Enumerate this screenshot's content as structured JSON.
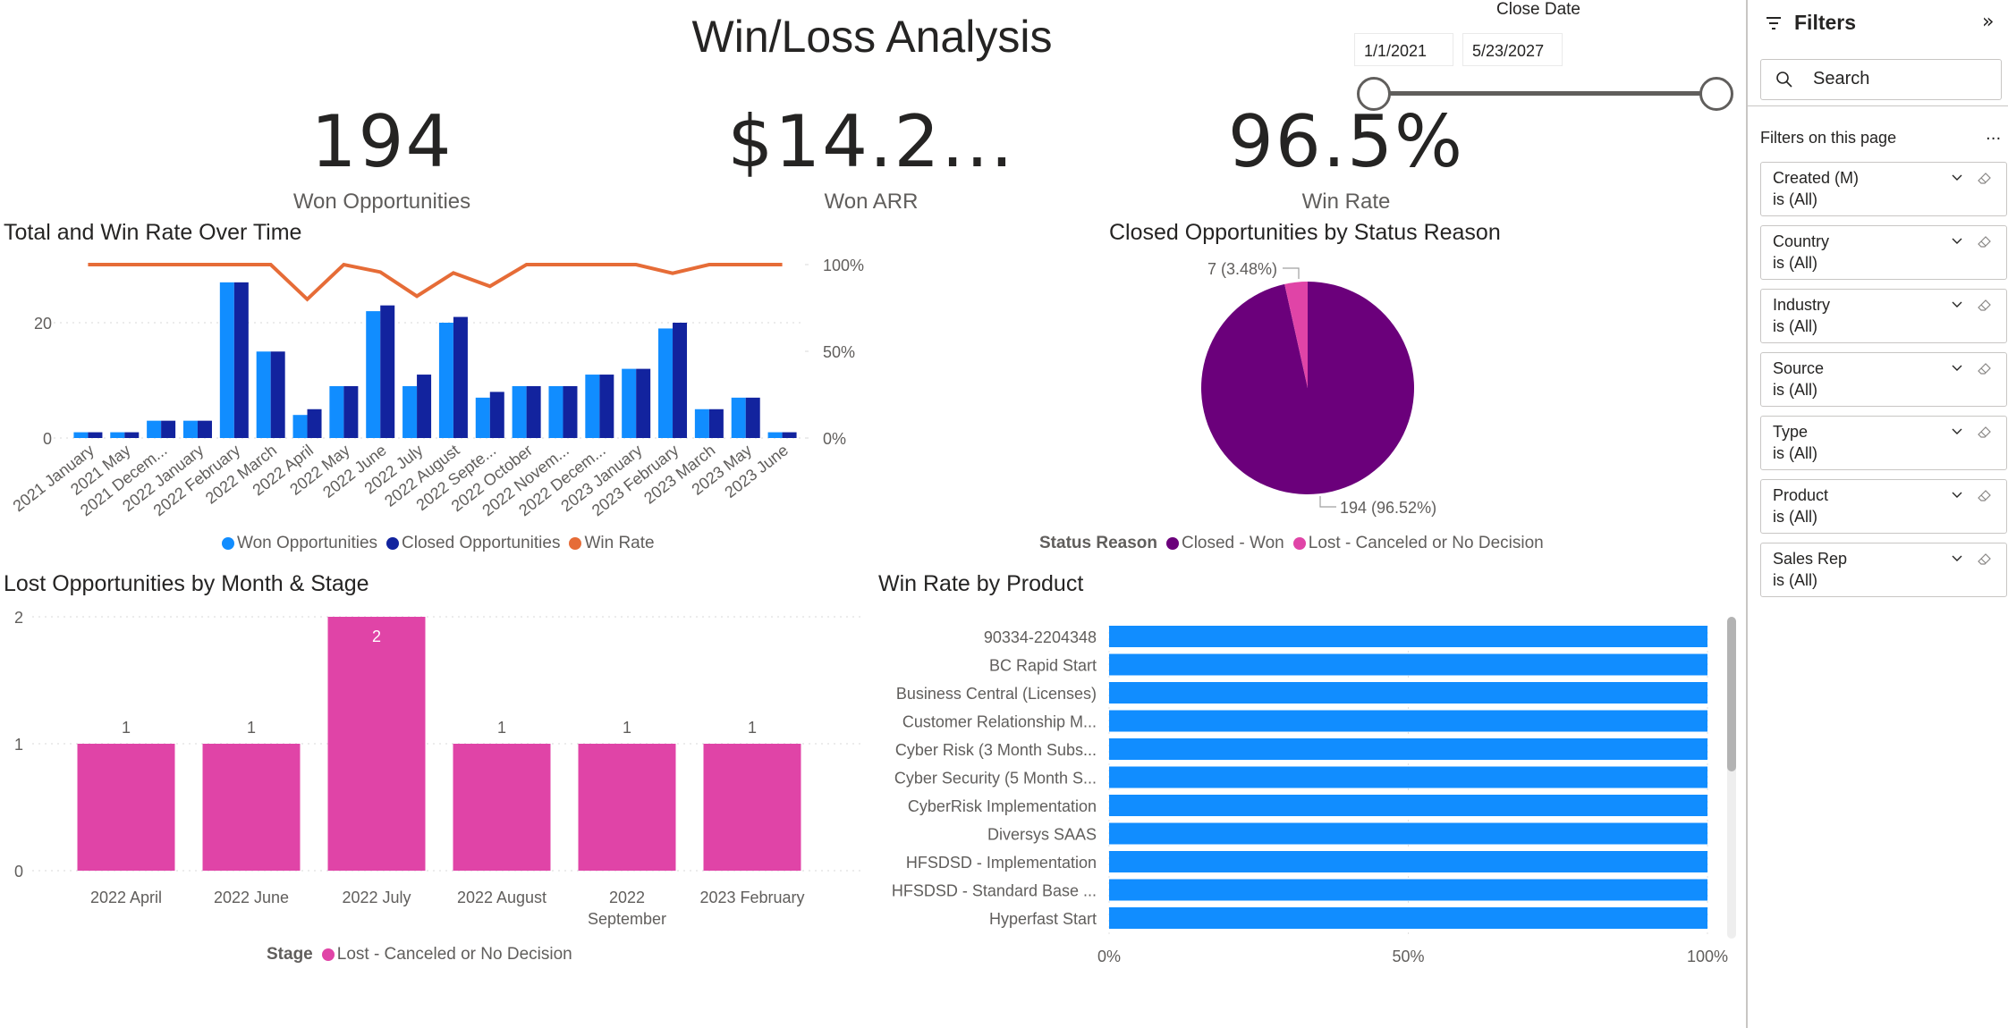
{
  "report": {
    "title": "Win/Loss Analysis"
  },
  "kpis": [
    {
      "value": "194",
      "label": "Won Opportunities"
    },
    {
      "value": "$14.2...",
      "label": "Won ARR"
    },
    {
      "value": "96.5%",
      "label": "Win Rate"
    }
  ],
  "close_date_slicer": {
    "label": "Close Date",
    "start": "1/1/2021",
    "end": "5/23/2027",
    "range_fraction": [
      0,
      1
    ]
  },
  "filter_pane": {
    "title": "Filters",
    "collapse_icon": "double-chevron-right-icon",
    "search_placeholder": "Search",
    "section_label": "Filters on this page",
    "more_label": "...",
    "filters": [
      {
        "name": "Created (M)",
        "value": "is (All)"
      },
      {
        "name": "Country",
        "value": "is (All)"
      },
      {
        "name": "Industry",
        "value": "is (All)"
      },
      {
        "name": "Source",
        "value": "is (All)"
      },
      {
        "name": "Type",
        "value": "is (All)"
      },
      {
        "name": "Product",
        "value": "is (All)"
      },
      {
        "name": "Sales Rep",
        "value": "is (All)"
      }
    ]
  },
  "colors": {
    "won": "#118dff",
    "closed": "#12239e",
    "win_rate": "#e66c37",
    "closed_won": "#6b007b",
    "lost": "#e044a7",
    "product_bar": "#118dff"
  },
  "chart_data": [
    {
      "id": "total-win-rate",
      "type": "bar",
      "title": "Total and Win Rate Over Time",
      "categories": [
        "2021 January",
        "2021 May",
        "2021 Decem...",
        "2022 January",
        "2022 February",
        "2022 March",
        "2022 April",
        "2022 May",
        "2022 June",
        "2022 July",
        "2022 August",
        "2022 Septe...",
        "2022 October",
        "2022 Novem...",
        "2022 Decem...",
        "2023 January",
        "2023 February",
        "2023 March",
        "2023 May",
        "2023 June"
      ],
      "series": [
        {
          "name": "Won Opportunities",
          "type": "bar",
          "axis": "left",
          "values": [
            1,
            1,
            3,
            3,
            27,
            15,
            4,
            9,
            22,
            9,
            20,
            7,
            9,
            9,
            11,
            12,
            19,
            5,
            7,
            1
          ]
        },
        {
          "name": "Closed Opportunities",
          "type": "bar",
          "axis": "left",
          "values": [
            1,
            1,
            3,
            3,
            27,
            15,
            5,
            9,
            23,
            11,
            21,
            8,
            9,
            9,
            11,
            12,
            20,
            5,
            7,
            1
          ]
        },
        {
          "name": "Win Rate",
          "type": "line",
          "axis": "right",
          "values": [
            100,
            100,
            100,
            100,
            100,
            100,
            80,
            100,
            95.7,
            81.8,
            95.2,
            87.5,
            100,
            100,
            100,
            100,
            95,
            100,
            100,
            100
          ]
        }
      ],
      "y_left_ticks": [
        "0",
        "20"
      ],
      "y_left_range": [
        0,
        30
      ],
      "y_right_ticks": [
        "0%",
        "50%",
        "100%"
      ],
      "y_right_range": [
        0,
        100
      ],
      "legend": [
        "Won Opportunities",
        "Closed Opportunities",
        "Win Rate"
      ],
      "legend_position": "bottom",
      "grid": true
    },
    {
      "id": "status-reason",
      "type": "pie",
      "title": "Closed Opportunities by Status Reason",
      "legend_title": "Status Reason",
      "slices": [
        {
          "label": "Closed - Won",
          "value": 194,
          "percent": 96.52,
          "data_label": "194 (96.52%)"
        },
        {
          "label": "Lost - Canceled or No Decision",
          "value": 7,
          "percent": 3.48,
          "data_label": "7 (3.48%)"
        }
      ],
      "legend_position": "bottom"
    },
    {
      "id": "lost-by-month",
      "type": "bar",
      "title": "Lost Opportunities by Month & Stage",
      "categories": [
        "2022 April",
        "2022 June",
        "2022 July",
        "2022 August",
        "2022 September",
        "2023 February"
      ],
      "category_lines": [
        [
          "2022 April"
        ],
        [
          "2022 June"
        ],
        [
          "2022 July"
        ],
        [
          "2022 August"
        ],
        [
          "2022",
          "September"
        ],
        [
          "2023 February"
        ]
      ],
      "series": [
        {
          "name": "Lost - Canceled or No Decision",
          "values": [
            1,
            1,
            2,
            1,
            1,
            1
          ]
        }
      ],
      "y_ticks": [
        "0",
        "1",
        "2"
      ],
      "ylim": [
        0,
        2
      ],
      "legend_title": "Stage",
      "legend_position": "bottom",
      "grid": true
    },
    {
      "id": "win-rate-product",
      "type": "bar",
      "orientation": "horizontal",
      "title": "Win Rate by Product",
      "categories": [
        "90334-2204348",
        "BC Rapid Start",
        "Business Central (Licenses)",
        "Customer Relationship M...",
        "Cyber Risk (3 Month Subs...",
        "Cyber Security (5 Month S...",
        "CyberRisk Implementation",
        "Diversys SAAS",
        "HFSDSD - Implementation",
        "HFSDSD - Standard Base ...",
        "Hyperfast Start"
      ],
      "values": [
        100,
        100,
        100,
        100,
        100,
        100,
        100,
        100,
        100,
        100,
        100
      ],
      "x_ticks": [
        "0%",
        "50%",
        "100%"
      ],
      "xlim": [
        0,
        100
      ],
      "scroll_fraction": 0.48,
      "grid": true
    }
  ]
}
